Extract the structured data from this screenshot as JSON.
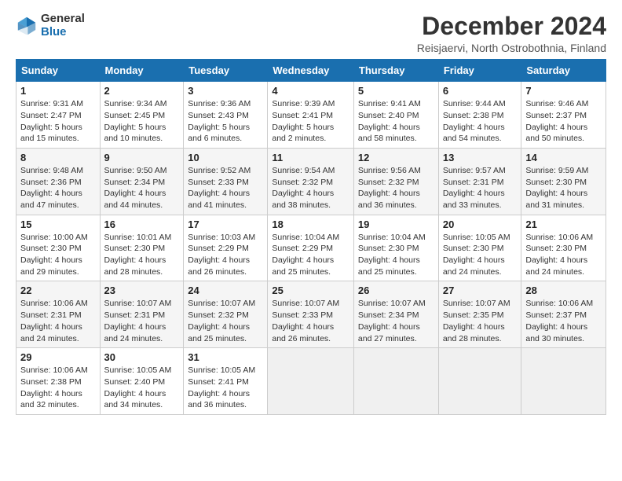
{
  "logo": {
    "general": "General",
    "blue": "Blue"
  },
  "title": "December 2024",
  "subtitle": "Reisjaervi, North Ostrobothnia, Finland",
  "days_of_week": [
    "Sunday",
    "Monday",
    "Tuesday",
    "Wednesday",
    "Thursday",
    "Friday",
    "Saturday"
  ],
  "weeks": [
    [
      {
        "day": "1",
        "sunrise": "9:31 AM",
        "sunset": "2:47 PM",
        "daylight": "5 hours and 15 minutes."
      },
      {
        "day": "2",
        "sunrise": "9:34 AM",
        "sunset": "2:45 PM",
        "daylight": "5 hours and 10 minutes."
      },
      {
        "day": "3",
        "sunrise": "9:36 AM",
        "sunset": "2:43 PM",
        "daylight": "5 hours and 6 minutes."
      },
      {
        "day": "4",
        "sunrise": "9:39 AM",
        "sunset": "2:41 PM",
        "daylight": "5 hours and 2 minutes."
      },
      {
        "day": "5",
        "sunrise": "9:41 AM",
        "sunset": "2:40 PM",
        "daylight": "4 hours and 58 minutes."
      },
      {
        "day": "6",
        "sunrise": "9:44 AM",
        "sunset": "2:38 PM",
        "daylight": "4 hours and 54 minutes."
      },
      {
        "day": "7",
        "sunrise": "9:46 AM",
        "sunset": "2:37 PM",
        "daylight": "4 hours and 50 minutes."
      }
    ],
    [
      {
        "day": "8",
        "sunrise": "9:48 AM",
        "sunset": "2:36 PM",
        "daylight": "4 hours and 47 minutes."
      },
      {
        "day": "9",
        "sunrise": "9:50 AM",
        "sunset": "2:34 PM",
        "daylight": "4 hours and 44 minutes."
      },
      {
        "day": "10",
        "sunrise": "9:52 AM",
        "sunset": "2:33 PM",
        "daylight": "4 hours and 41 minutes."
      },
      {
        "day": "11",
        "sunrise": "9:54 AM",
        "sunset": "2:32 PM",
        "daylight": "4 hours and 38 minutes."
      },
      {
        "day": "12",
        "sunrise": "9:56 AM",
        "sunset": "2:32 PM",
        "daylight": "4 hours and 36 minutes."
      },
      {
        "day": "13",
        "sunrise": "9:57 AM",
        "sunset": "2:31 PM",
        "daylight": "4 hours and 33 minutes."
      },
      {
        "day": "14",
        "sunrise": "9:59 AM",
        "sunset": "2:30 PM",
        "daylight": "4 hours and 31 minutes."
      }
    ],
    [
      {
        "day": "15",
        "sunrise": "10:00 AM",
        "sunset": "2:30 PM",
        "daylight": "4 hours and 29 minutes."
      },
      {
        "day": "16",
        "sunrise": "10:01 AM",
        "sunset": "2:30 PM",
        "daylight": "4 hours and 28 minutes."
      },
      {
        "day": "17",
        "sunrise": "10:03 AM",
        "sunset": "2:29 PM",
        "daylight": "4 hours and 26 minutes."
      },
      {
        "day": "18",
        "sunrise": "10:04 AM",
        "sunset": "2:29 PM",
        "daylight": "4 hours and 25 minutes."
      },
      {
        "day": "19",
        "sunrise": "10:04 AM",
        "sunset": "2:30 PM",
        "daylight": "4 hours and 25 minutes."
      },
      {
        "day": "20",
        "sunrise": "10:05 AM",
        "sunset": "2:30 PM",
        "daylight": "4 hours and 24 minutes."
      },
      {
        "day": "21",
        "sunrise": "10:06 AM",
        "sunset": "2:30 PM",
        "daylight": "4 hours and 24 minutes."
      }
    ],
    [
      {
        "day": "22",
        "sunrise": "10:06 AM",
        "sunset": "2:31 PM",
        "daylight": "4 hours and 24 minutes."
      },
      {
        "day": "23",
        "sunrise": "10:07 AM",
        "sunset": "2:31 PM",
        "daylight": "4 hours and 24 minutes."
      },
      {
        "day": "24",
        "sunrise": "10:07 AM",
        "sunset": "2:32 PM",
        "daylight": "4 hours and 25 minutes."
      },
      {
        "day": "25",
        "sunrise": "10:07 AM",
        "sunset": "2:33 PM",
        "daylight": "4 hours and 26 minutes."
      },
      {
        "day": "26",
        "sunrise": "10:07 AM",
        "sunset": "2:34 PM",
        "daylight": "4 hours and 27 minutes."
      },
      {
        "day": "27",
        "sunrise": "10:07 AM",
        "sunset": "2:35 PM",
        "daylight": "4 hours and 28 minutes."
      },
      {
        "day": "28",
        "sunrise": "10:06 AM",
        "sunset": "2:37 PM",
        "daylight": "4 hours and 30 minutes."
      }
    ],
    [
      {
        "day": "29",
        "sunrise": "10:06 AM",
        "sunset": "2:38 PM",
        "daylight": "4 hours and 32 minutes."
      },
      {
        "day": "30",
        "sunrise": "10:05 AM",
        "sunset": "2:40 PM",
        "daylight": "4 hours and 34 minutes."
      },
      {
        "day": "31",
        "sunrise": "10:05 AM",
        "sunset": "2:41 PM",
        "daylight": "4 hours and 36 minutes."
      },
      null,
      null,
      null,
      null
    ]
  ],
  "labels": {
    "sunrise": "Sunrise: ",
    "sunset": "Sunset: ",
    "daylight": "Daylight: "
  }
}
